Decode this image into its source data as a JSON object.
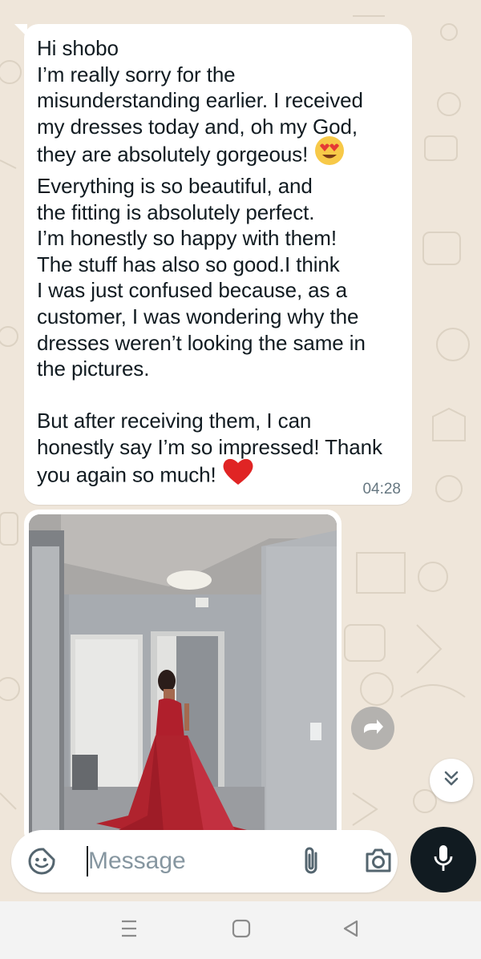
{
  "conversation": {
    "message": {
      "text": "Hi shobo\nI’m really sorry for the\nmisunderstanding earlier. I received\nmy dresses today and, oh my God,\nthey are absolutely gorgeous! ",
      "text_2": "\nEverything is so beautiful, and\nthe fitting is absolutely perfect.\nI’m honestly so happy with them!\nThe stuff has also so good.I think\nI was just confused because, as a\ncustomer, I was wondering why the\ndresses weren’t looking the same in\nthe pictures.\n\nBut after receiving them, I can\nhonestly say I’m so impressed! Thank\nyou again so much! ",
      "time": "04:28",
      "emoji_1": "heart-eyes-emoji",
      "emoji_2": "red-heart-emoji"
    },
    "image_message": {
      "content": "photo-woman-red-gown-hallway"
    }
  },
  "composer": {
    "placeholder": "Message",
    "value": ""
  },
  "icons": {
    "sticker": "sticker-icon",
    "attach": "paperclip-icon",
    "camera": "camera-icon",
    "mic": "microphone-icon",
    "forward": "forward-icon",
    "scroll_down": "double-chevron-down-icon"
  },
  "colors": {
    "chat_background": "#efe6da",
    "bubble": "#ffffff",
    "text": "#111b21",
    "timestamp": "#667781",
    "mic_button": "#111b21",
    "gown": "#b0232e"
  }
}
